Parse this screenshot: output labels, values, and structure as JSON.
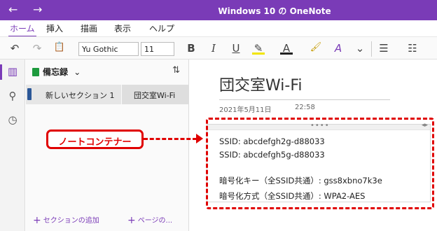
{
  "titlebar": {
    "title": "Windows 10 の OneNote",
    "back_icon": "←",
    "forward_icon": "→"
  },
  "tabs": [
    "ホーム",
    "挿入",
    "描画",
    "表示",
    "ヘルプ"
  ],
  "ribbon": {
    "undo_icon": "↶",
    "redo_icon": "↷",
    "clipboard_icon": "📋",
    "font_name": "Yu Gothic",
    "font_size": "11",
    "bold": "B",
    "italic": "I",
    "underline": "U",
    "highlight_icon": "✎",
    "font_color_icon": "A",
    "format_painter_icon": "🖌",
    "clear_format_icon": "A",
    "more_icon": "⌄",
    "bullets_icon": "☰",
    "numbering_icon": "☷"
  },
  "leftrail": {
    "notebooks_icon": "▥",
    "search_icon": "⚲",
    "recent_icon": "◷"
  },
  "navpane": {
    "notebook": "備忘録",
    "chevron": "⌄",
    "sort_icon": "⇅",
    "section": "新しいセクション 1",
    "page": "団交室Wi-Fi",
    "add_section": "セクションの追加",
    "add_page": "ページの...",
    "plus": "+"
  },
  "page": {
    "title": "団交室Wi-Fi",
    "date": "2021年5月11日",
    "time": "22:58",
    "lines": [
      "SSID: abcdefgh2g-d88033",
      "SSID: abcdefgh5g-d88033",
      "暗号化キー（全SSID共通）: gss8xbno7k3e",
      "暗号化方式（全SSID共通）: WPA2-AES"
    ],
    "grip_dots": "••••",
    "resize_icon": "◂▸"
  },
  "annotation": {
    "callout": "ノートコンテナー",
    "color": "#e00000"
  },
  "colors": {
    "accent": "#7a3bb7",
    "notebook_green": "#1e9b3e",
    "section_blue": "#2b5797"
  }
}
